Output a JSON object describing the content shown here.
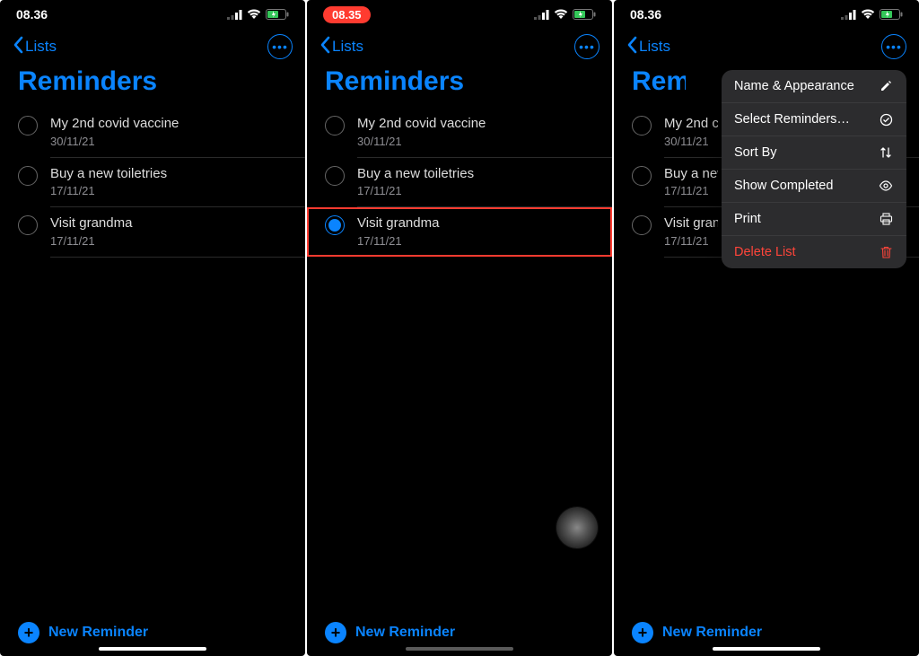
{
  "status": {
    "time_a": "08.36",
    "time_b": "08.35",
    "time_c": "08.36"
  },
  "nav": {
    "back_label": "Lists"
  },
  "list_title": "Reminders",
  "reminders": [
    {
      "title": "My 2nd covid vaccine",
      "date": "30/11/21"
    },
    {
      "title": "Buy a new toiletries",
      "date": "17/11/21"
    },
    {
      "title": "Visit grandma",
      "date": "17/11/21"
    }
  ],
  "new_reminder_label": "New Reminder",
  "menu": {
    "name_appearance": "Name & Appearance",
    "select_reminders": "Select Reminders…",
    "sort_by": "Sort By",
    "show_completed": "Show Completed",
    "print": "Print",
    "delete_list": "Delete List"
  }
}
